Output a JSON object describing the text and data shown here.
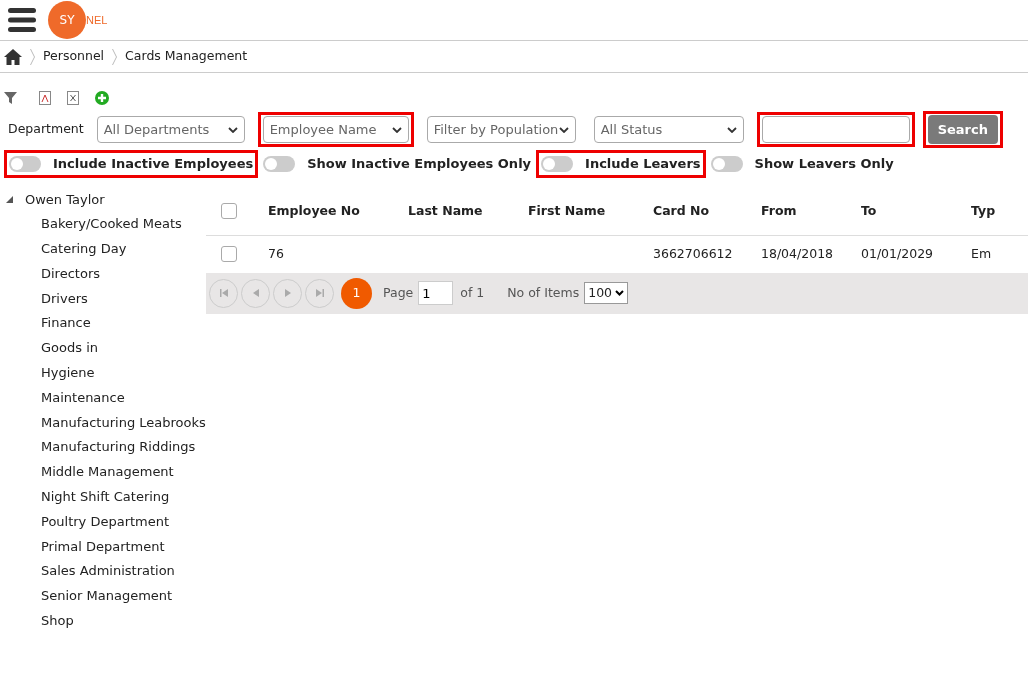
{
  "header": {
    "logo": {
      "left": "SY",
      "right": "NEL"
    }
  },
  "breadcrumb": [
    {
      "label": "Personnel"
    },
    {
      "label": "Cards Management"
    }
  ],
  "filters": {
    "department_label": "Department",
    "selects": [
      {
        "value": "All Departments",
        "highlighted": false
      },
      {
        "value": "Employee Name",
        "highlighted": true
      },
      {
        "value": "Filter by Population",
        "highlighted": false
      },
      {
        "value": "All Status",
        "highlighted": false
      }
    ],
    "search_field": {
      "highlighted": true
    },
    "search_button": {
      "label": "Search",
      "highlighted": true
    },
    "toggles": [
      {
        "label": "Include Inactive Employees",
        "on": false,
        "highlighted": true
      },
      {
        "label": "Show Inactive Employees Only",
        "on": false,
        "highlighted": false
      },
      {
        "label": "Include Leavers",
        "on": false,
        "highlighted": true
      },
      {
        "label": "Show Leavers Only",
        "on": false,
        "highlighted": false
      }
    ]
  },
  "tree": [
    {
      "label": "Owen Taylor",
      "expanded": true,
      "children": [
        {
          "label": "Bakery/Cooked Meats"
        },
        {
          "label": "Catering Day"
        },
        {
          "label": "Directors"
        },
        {
          "label": "Drivers"
        },
        {
          "label": "Finance"
        },
        {
          "label": "Goods in"
        },
        {
          "label": "Hygiene"
        },
        {
          "label": "Maintenance"
        },
        {
          "label": "Manufacturing Leabrooks"
        },
        {
          "label": "Manufacturing Riddings"
        },
        {
          "label": "Middle Management"
        },
        {
          "label": "Night Shift Catering"
        },
        {
          "label": "Poultry Department"
        },
        {
          "label": "Primal Department"
        },
        {
          "label": "Sales Administration"
        },
        {
          "label": "Senior Management"
        },
        {
          "label": "Shop"
        }
      ]
    }
  ],
  "table": {
    "select_all_checked": false,
    "columns": [
      "Employee No",
      "Last Name",
      "First Name",
      "Card No",
      "From",
      "To",
      "Typ"
    ],
    "rows": [
      {
        "checked": false,
        "cells": [
          "76",
          "",
          "",
          "3662706612",
          "18/04/2018",
          "01/01/2029",
          "Em"
        ]
      }
    ]
  },
  "pager": {
    "current": "1",
    "page_label": "Page",
    "page_value": "1",
    "of_label": "of 1",
    "items_label": "No of Items",
    "items_value": "100"
  }
}
